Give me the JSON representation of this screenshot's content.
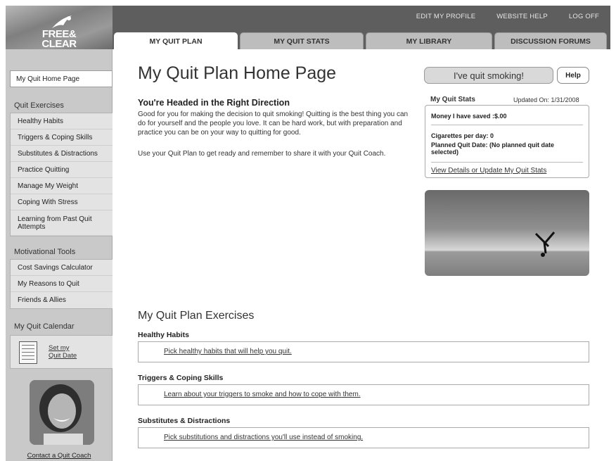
{
  "header": {
    "logo_text": "FREE& CLEAR",
    "top_links": [
      "EDIT MY PROFILE",
      "WEBSITE HELP",
      "LOG OFF"
    ],
    "tabs": [
      "MY QUIT PLAN",
      "MY QUIT STATS",
      "MY LIBRARY",
      "DISCUSSION FORUMS"
    ],
    "active_tab": "MY QUIT PLAN"
  },
  "sidebar": {
    "home": "My Quit Home Page",
    "quit_exercises_heading": "Quit Exercises",
    "quit_exercises": [
      "Healthy Habits",
      "Triggers & Coping Skills",
      "Substitutes & Distractions",
      "Practice Quitting",
      "Manage My Weight",
      "Coping With Stress",
      "Learning from Past Quit Attempts"
    ],
    "motivational_heading": "Motivational Tools",
    "motivational": [
      "Cost Savings Calculator",
      "My Reasons to Quit",
      "Friends & Allies"
    ],
    "calendar_heading": "My Quit Calendar",
    "calendar_link_line1": "Set my",
    "calendar_link_line2": "Quit Date",
    "contact_link": "Contact a Quit Coach"
  },
  "main": {
    "title": "My Quit Plan Home Page",
    "subtitle": "You're Headed in the Right Direction",
    "para1": "Good for you for making the decision to quit smoking! Quitting is the best thing you can do for yourself and the people you love. It can be hard work, but with preparation and practice you can be on your way to quitting for good.",
    "para2": "Use your Quit Plan to get ready and remember to share it with your Quit Coach.",
    "quit_button": "I've quit smoking!",
    "help_button": "Help",
    "stats": {
      "heading": "My Quit Stats",
      "updated": "Updated On: 1/31/2008",
      "money": "Money I have saved :$.00",
      "cigarettes": "Cigarettes per day: 0",
      "planned": "Planned Quit Date: (No planned quit date selected)",
      "link": "View Details or Update My Quit Stats"
    },
    "exercises_title": "My Quit Plan Exercises",
    "exercises": [
      {
        "heading": "Healthy Habits",
        "link": "Pick healthy habits that will help you quit."
      },
      {
        "heading": "Triggers & Coping Skills",
        "link": "Learn about your triggers to smoke and how to cope with them."
      },
      {
        "heading": "Substitutes & Distractions",
        "link": "Pick substitutions and distractions you'll use instead of smoking."
      }
    ]
  }
}
